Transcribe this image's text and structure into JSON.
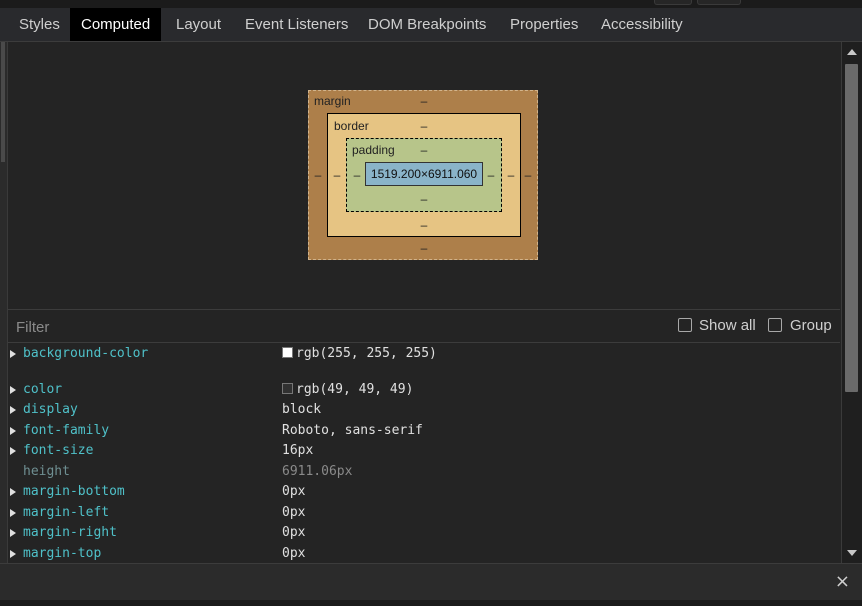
{
  "tabs": [
    {
      "label": "Styles",
      "active": false
    },
    {
      "label": "Computed",
      "active": true
    },
    {
      "label": "Layout",
      "active": false
    },
    {
      "label": "Event Listeners",
      "active": false
    },
    {
      "label": "DOM Breakpoints",
      "active": false
    },
    {
      "label": "Properties",
      "active": false
    },
    {
      "label": "Accessibility",
      "active": false
    }
  ],
  "box_model": {
    "margin_label": "margin",
    "border_label": "border",
    "padding_label": "padding",
    "content_size": "1519.200×6911.060",
    "margin": {
      "top": "–",
      "right": "–",
      "bottom": "–",
      "left": "–"
    },
    "border": {
      "top": "–",
      "right": "–",
      "bottom": "–",
      "left": "–"
    },
    "padding": {
      "top": "–",
      "right": "–",
      "bottom": "–",
      "left": "–"
    }
  },
  "filter": {
    "placeholder": "Filter",
    "show_all_label": "Show all",
    "show_all_checked": false,
    "group_label": "Group",
    "group_checked": false
  },
  "properties": [
    {
      "name": "background-color",
      "value": "rgb(255, 255, 255)",
      "swatch": "#ffffff",
      "expandable": true,
      "inherited": false
    },
    {
      "name": "color",
      "value": "rgb(49, 49, 49)",
      "swatch": "#313131",
      "expandable": true,
      "inherited": false
    },
    {
      "name": "display",
      "value": "block",
      "expandable": true,
      "inherited": false
    },
    {
      "name": "font-family",
      "value": "Roboto, sans-serif",
      "expandable": true,
      "inherited": false
    },
    {
      "name": "font-size",
      "value": "16px",
      "expandable": true,
      "inherited": false
    },
    {
      "name": "height",
      "value": "6911.06px",
      "expandable": false,
      "inherited": true
    },
    {
      "name": "margin-bottom",
      "value": "0px",
      "expandable": true,
      "inherited": false
    },
    {
      "name": "margin-left",
      "value": "0px",
      "expandable": true,
      "inherited": false
    },
    {
      "name": "margin-right",
      "value": "0px",
      "expandable": true,
      "inherited": false
    },
    {
      "name": "margin-top",
      "value": "0px",
      "expandable": true,
      "inherited": false
    }
  ],
  "bottom": {
    "close_icon": "×"
  },
  "colors": {
    "background": "#242424",
    "active_tab": "#000000",
    "margin_box": "#ad7f4a",
    "border_box": "#e6c483",
    "padding_box": "#b7c58a",
    "content_box": "#8ab4c9",
    "property_name": "#5db0d7"
  }
}
